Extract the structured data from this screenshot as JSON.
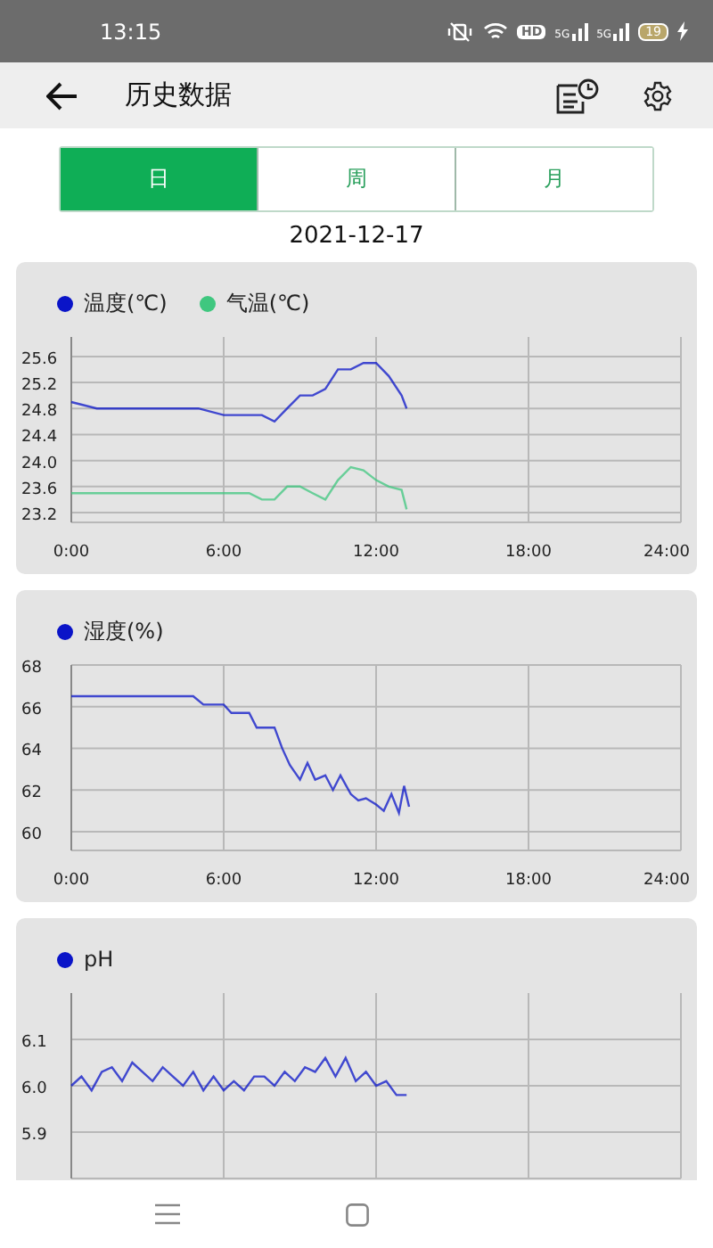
{
  "status_bar": {
    "time": "13:15",
    "badge": "HD",
    "signals": [
      "5G",
      "5G"
    ],
    "battery": "19"
  },
  "app_bar": {
    "title": "历史数据"
  },
  "tabs": [
    {
      "label": "日",
      "selected": true
    },
    {
      "label": "周",
      "selected": false
    },
    {
      "label": "月",
      "selected": false
    }
  ],
  "date": "2021-12-17",
  "charts": [
    {
      "chart_data": {
        "type": "line",
        "x": [
          0,
          1,
          2,
          3,
          4,
          5,
          6,
          6.5,
          7,
          7.5,
          8,
          8.5,
          9,
          9.5,
          10,
          10.5,
          11,
          11.5,
          12,
          12.5,
          13,
          13.2
        ],
        "series": [
          {
            "name": "温度(℃)",
            "color": "#0a14c8",
            "values": [
              24.9,
              24.8,
              24.8,
              24.8,
              24.8,
              24.8,
              24.7,
              24.7,
              24.7,
              24.7,
              24.6,
              24.8,
              25.0,
              25.0,
              25.1,
              25.4,
              25.4,
              25.5,
              25.5,
              25.3,
              25.0,
              24.8
            ]
          },
          {
            "name": "气温(℃)",
            "color": "#3fc77f",
            "values": [
              23.5,
              23.5,
              23.5,
              23.5,
              23.5,
              23.5,
              23.5,
              23.5,
              23.5,
              23.4,
              23.4,
              23.6,
              23.6,
              23.5,
              23.4,
              23.7,
              23.9,
              23.85,
              23.7,
              23.6,
              23.55,
              23.25
            ]
          }
        ],
        "xlim": [
          0,
          24
        ],
        "ylim": [
          23.05,
          25.9
        ],
        "grid": true,
        "xticks": [
          {
            "value": 0,
            "label": "0:00"
          },
          {
            "value": 6,
            "label": "6:00"
          },
          {
            "value": 12,
            "label": "12:00"
          },
          {
            "value": 18,
            "label": "18:00"
          },
          {
            "value": 24,
            "label": "24:00"
          }
        ],
        "yticks": [
          {
            "value": 23.2,
            "label": "23.2"
          },
          {
            "value": 23.6,
            "label": "23.6"
          },
          {
            "value": 24.0,
            "label": "24.0"
          },
          {
            "value": 24.4,
            "label": "24.4"
          },
          {
            "value": 24.8,
            "label": "24.8"
          },
          {
            "value": 25.2,
            "label": "25.2"
          },
          {
            "value": 25.6,
            "label": "25.6"
          }
        ]
      }
    },
    {
      "chart_data": {
        "type": "line",
        "x": [
          0,
          2,
          4,
          4.8,
          5.2,
          6,
          6.3,
          7,
          7.3,
          8,
          8.3,
          8.6,
          9,
          9.3,
          9.6,
          10,
          10.3,
          10.6,
          11,
          11.3,
          11.6,
          12,
          12.3,
          12.6,
          12.9,
          13.1,
          13.3
        ],
        "series": [
          {
            "name": "湿度(%)",
            "color": "#0a14c8",
            "values": [
              66.5,
              66.5,
              66.5,
              66.5,
              66.1,
              66.1,
              65.7,
              65.7,
              65.0,
              65.0,
              64.0,
              63.2,
              62.5,
              63.3,
              62.5,
              62.7,
              62.0,
              62.7,
              61.8,
              61.5,
              61.6,
              61.3,
              61.0,
              61.8,
              60.9,
              62.2,
              61.2
            ]
          }
        ],
        "xlim": [
          0,
          24
        ],
        "ylim": [
          59.1,
          68
        ],
        "grid": true,
        "xticks": [
          {
            "value": 0,
            "label": "0:00"
          },
          {
            "value": 6,
            "label": "6:00"
          },
          {
            "value": 12,
            "label": "12:00"
          },
          {
            "value": 18,
            "label": "18:00"
          },
          {
            "value": 24,
            "label": "24:00"
          }
        ],
        "yticks": [
          {
            "value": 60,
            "label": "60"
          },
          {
            "value": 62,
            "label": "62"
          },
          {
            "value": 64,
            "label": "64"
          },
          {
            "value": 66,
            "label": "66"
          },
          {
            "value": 68,
            "label": "68"
          }
        ]
      }
    },
    {
      "chart_data": {
        "type": "line",
        "x": [
          0,
          0.4,
          0.8,
          1.2,
          1.6,
          2,
          2.4,
          2.8,
          3.2,
          3.6,
          4,
          4.4,
          4.8,
          5.2,
          5.6,
          6,
          6.4,
          6.8,
          7.2,
          7.6,
          8,
          8.4,
          8.8,
          9.2,
          9.6,
          10,
          10.4,
          10.8,
          11.2,
          11.6,
          12,
          12.4,
          12.8,
          13.2
        ],
        "series": [
          {
            "name": "pH",
            "color": "#0a14c8",
            "values": [
              6.0,
              6.02,
              5.99,
              6.03,
              6.04,
              6.01,
              6.05,
              6.03,
              6.01,
              6.04,
              6.02,
              6.0,
              6.03,
              5.99,
              6.02,
              5.99,
              6.01,
              5.99,
              6.02,
              6.02,
              6.0,
              6.03,
              6.01,
              6.04,
              6.03,
              6.06,
              6.02,
              6.06,
              6.01,
              6.03,
              6.0,
              6.01,
              5.98,
              5.98
            ]
          }
        ],
        "xlim": [
          0,
          24
        ],
        "ylim": [
          5.8,
          6.2
        ],
        "grid": true,
        "yticks": [
          {
            "value": 5.9,
            "label": "5.9"
          },
          {
            "value": 6.0,
            "label": "6.0"
          },
          {
            "value": 6.1,
            "label": "6.1"
          }
        ]
      }
    }
  ]
}
